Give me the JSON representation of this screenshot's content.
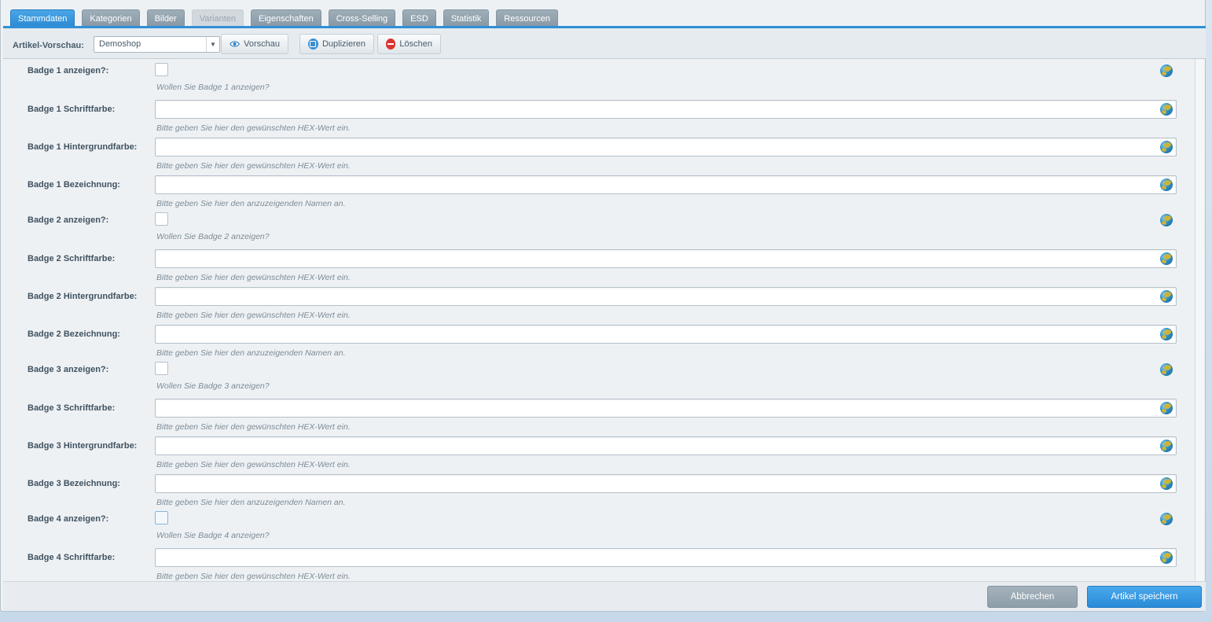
{
  "tabs": [
    {
      "label": "Stammdaten",
      "state": "active"
    },
    {
      "label": "Kategorien",
      "state": "normal"
    },
    {
      "label": "Bilder",
      "state": "normal"
    },
    {
      "label": "Varianten",
      "state": "disabled"
    },
    {
      "label": "Eigenschaften",
      "state": "normal"
    },
    {
      "label": "Cross-Selling",
      "state": "normal"
    },
    {
      "label": "ESD",
      "state": "normal"
    },
    {
      "label": "Statistik",
      "state": "normal"
    },
    {
      "label": "Ressourcen",
      "state": "normal"
    }
  ],
  "toolbar": {
    "preview_label": "Artikel-Vorschau:",
    "shop_select_value": "Demoshop",
    "preview_button": "Vorschau",
    "duplicate_button": "Duplizieren",
    "delete_button": "Löschen"
  },
  "fields": [
    {
      "label": "Badge 1 anzeigen?:",
      "type": "checkbox",
      "help": "Wollen Sie Badge 1 anzeigen?"
    },
    {
      "label": "Badge 1 Schriftfarbe:",
      "type": "text",
      "value": "",
      "help": "Bitte geben Sie hier den gewünschten HEX-Wert ein."
    },
    {
      "label": "Badge 1 Hintergrundfarbe:",
      "type": "text",
      "value": "",
      "help": "Bitte geben Sie hier den gewünschten HEX-Wert ein."
    },
    {
      "label": "Badge 1 Bezeichnung:",
      "type": "text",
      "value": "",
      "help": "Bitte geben Sie hier den anzuzeigenden Namen an."
    },
    {
      "label": "Badge 2 anzeigen?:",
      "type": "checkbox",
      "help": "Wollen Sie Badge 2 anzeigen?"
    },
    {
      "label": "Badge 2 Schriftfarbe:",
      "type": "text",
      "value": "",
      "help": "Bitte geben Sie hier den gewünschten HEX-Wert ein."
    },
    {
      "label": "Badge 2 Hintergrundfarbe:",
      "type": "text",
      "value": "",
      "help": "Bitte geben Sie hier den gewünschten HEX-Wert ein."
    },
    {
      "label": "Badge 2 Bezeichnung:",
      "type": "text",
      "value": "",
      "help": "Bitte geben Sie hier den anzuzeigenden Namen an."
    },
    {
      "label": "Badge 3 anzeigen?:",
      "type": "checkbox",
      "help": "Wollen Sie Badge 3 anzeigen?"
    },
    {
      "label": "Badge 3 Schriftfarbe:",
      "type": "text",
      "value": "",
      "help": "Bitte geben Sie hier den gewünschten HEX-Wert ein."
    },
    {
      "label": "Badge 3 Hintergrundfarbe:",
      "type": "text",
      "value": "",
      "help": "Bitte geben Sie hier den gewünschten HEX-Wert ein."
    },
    {
      "label": "Badge 3 Bezeichnung:",
      "type": "text",
      "value": "",
      "help": "Bitte geben Sie hier den anzuzeigenden Namen an."
    },
    {
      "label": "Badge 4 anzeigen?:",
      "type": "checkbox",
      "help": "Wollen Sie Badge 4 anzeigen?"
    },
    {
      "label": "Badge 4 Schriftfarbe:",
      "type": "text",
      "value": "",
      "help": "Bitte geben Sie hier den gewünschten HEX-Wert ein."
    }
  ],
  "footer": {
    "cancel_button": "Abbrechen",
    "save_button": "Artikel speichern"
  },
  "colors": {
    "accent": "#2f8fd8",
    "danger": "#d9342f"
  },
  "icons": {
    "translation": "globe-icon",
    "preview": "eye-icon",
    "duplicate": "duplicate-icon",
    "delete": "delete-icon",
    "dropdown": "chevron-down-icon"
  }
}
